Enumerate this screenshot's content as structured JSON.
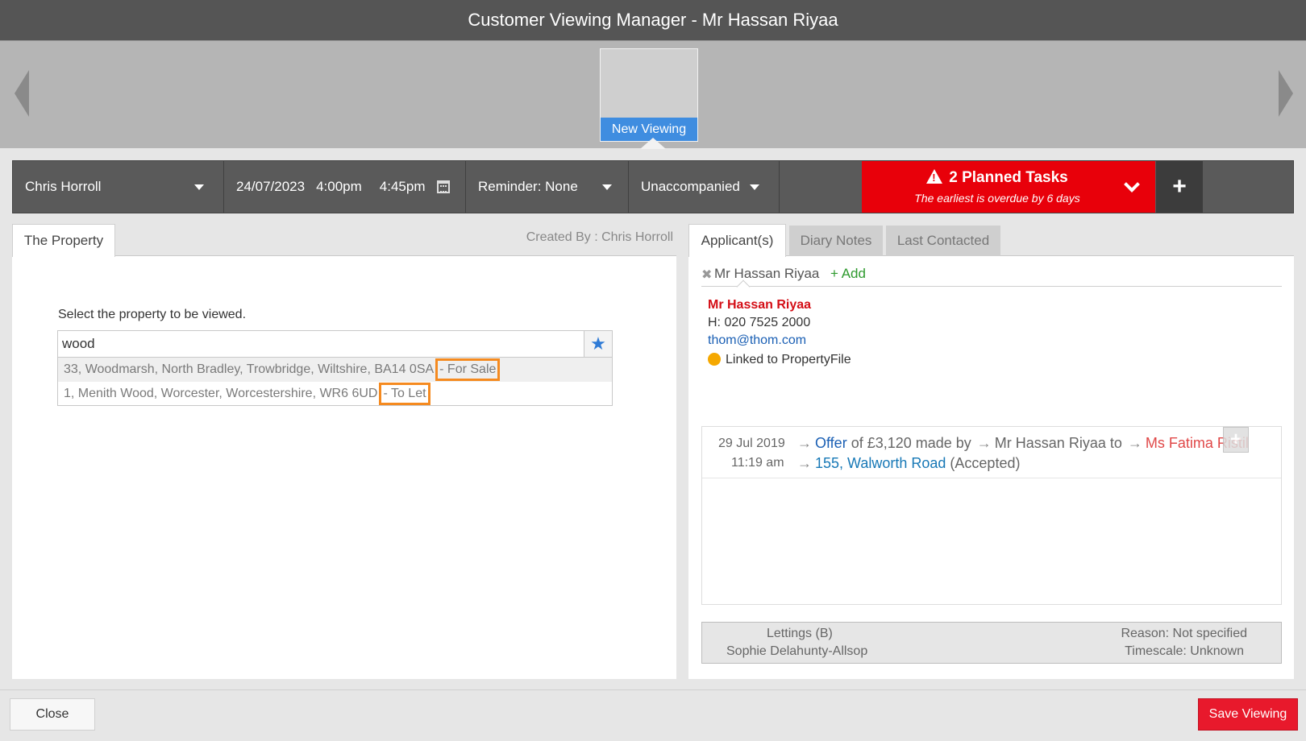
{
  "window": {
    "title": "Customer Viewing Manager - Mr Hassan Riyaa"
  },
  "carousel": {
    "thumb_label": "New Viewing"
  },
  "toolbar": {
    "negotiator": "Chris Horroll",
    "date": "24/07/2023",
    "start_time": "4:00pm",
    "end_time": "4:45pm",
    "reminder": "Reminder: None",
    "accompanied": "Unaccompanied",
    "tasks_title": "2 Planned Tasks",
    "tasks_subtitle": "The earliest is overdue by 6 days",
    "add_glyph": "+"
  },
  "property_panel": {
    "tab_label": "The Property",
    "created_by": "Created By : Chris Horroll",
    "select_label": "Select the property to be viewed.",
    "search_value": "wood",
    "suggestions": [
      {
        "address": "33, Woodmarsh, North Bradley, Trowbridge, Wiltshire, BA14 0SA",
        "status": "- For Sale"
      },
      {
        "address": "1, Menith Wood, Worcester, Worcestershire, WR6 6UD",
        "status": "- To Let"
      }
    ]
  },
  "applicant_panel": {
    "tabs": [
      "Applicant(s)",
      "Diary Notes",
      "Last Contacted"
    ],
    "applicant_chip": "Mr Hassan Riyaa",
    "add_label": "+ Add",
    "details": {
      "name": "Mr Hassan Riyaa",
      "phone": "H: 020 7525 2000",
      "email": "thom@thom.com",
      "linked": "Linked to PropertyFile"
    },
    "history": {
      "date": "29 Jul 2019",
      "time": "11:19 am",
      "offer_link": "Offer",
      "offer_text": " of £3,120 made by ",
      "from": "Mr Hassan Riyaa",
      "to_text": " to ",
      "to_name": "Ms Fatima Ristil",
      "property_link": "155, Walworth Road",
      "status": " (Accepted)"
    },
    "footer": {
      "department": "Lettings (B)",
      "person": "Sophie Delahunty-Allsop",
      "reason": "Reason: Not specified",
      "timescale": "Timescale: Unknown"
    }
  },
  "buttons": {
    "close": "Close",
    "save": "Save Viewing"
  },
  "colors": {
    "accent_red": "#e8000a",
    "save_red": "#e8192c",
    "thumb_blue": "#3f8de0",
    "highlight_orange": "#f58a1f"
  },
  "icons": [
    "chevron-left-icon",
    "chevron-right-icon",
    "caret-down-icon",
    "calendar-icon",
    "warning-icon",
    "chevron-down-icon",
    "plus-icon",
    "star-icon",
    "remove-icon",
    "arrow-right-icon",
    "status-dot-icon"
  ]
}
